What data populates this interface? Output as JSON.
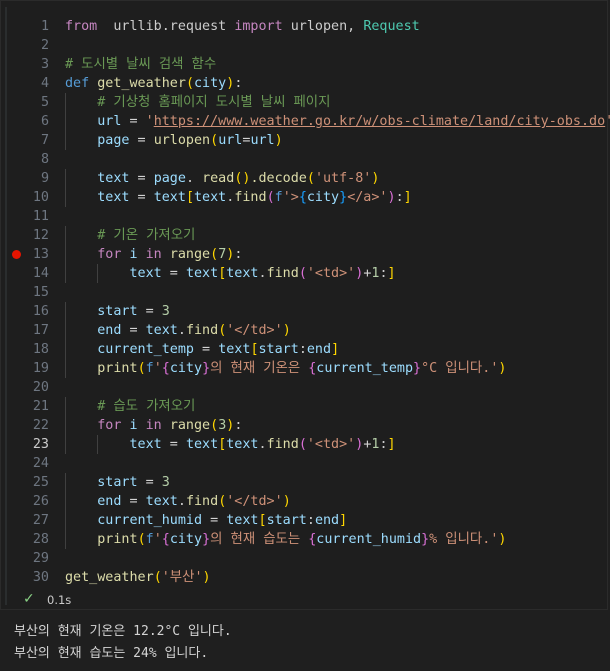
{
  "cell": {
    "lines": [
      {
        "n": "1",
        "t": [
          [
            "kw",
            "from"
          ],
          [
            "",
            "  "
          ],
          [
            "",
            "urllib.request "
          ],
          [
            "kw",
            "import"
          ],
          [
            "",
            " urlopen, "
          ],
          [
            "cls",
            "Request"
          ]
        ]
      },
      {
        "n": "2",
        "t": []
      },
      {
        "n": "3",
        "t": [
          [
            "cmt",
            "# 도시별 날씨 검색 함수"
          ]
        ]
      },
      {
        "n": "4",
        "t": [
          [
            "def",
            "def"
          ],
          [
            "",
            " "
          ],
          [
            "fn",
            "get_weather"
          ],
          [
            "b1",
            "("
          ],
          [
            "var",
            "city"
          ],
          [
            "b1",
            ")"
          ],
          [
            "",
            ":"
          ]
        ]
      },
      {
        "n": "5",
        "t": [
          [
            "",
            "    "
          ],
          [
            "cmt",
            "# 기상청 홈페이지 도시별 날씨 페이지"
          ]
        ]
      },
      {
        "n": "6",
        "t": [
          [
            "",
            "    "
          ],
          [
            "var",
            "url"
          ],
          [
            "op",
            " = "
          ],
          [
            "str",
            "'"
          ],
          [
            "str url",
            "https://www.weather.go.kr/w/obs-climate/land/city-obs.do"
          ],
          [
            "str",
            "'"
          ]
        ]
      },
      {
        "n": "7",
        "t": [
          [
            "",
            "    "
          ],
          [
            "var",
            "page"
          ],
          [
            "op",
            " = "
          ],
          [
            "fn",
            "urlopen"
          ],
          [
            "b1",
            "("
          ],
          [
            "var",
            "url"
          ],
          [
            "op",
            "="
          ],
          [
            "var",
            "url"
          ],
          [
            "b1",
            ")"
          ]
        ]
      },
      {
        "n": "8",
        "t": []
      },
      {
        "n": "9",
        "t": [
          [
            "",
            "    "
          ],
          [
            "var",
            "text"
          ],
          [
            "op",
            " = "
          ],
          [
            "var",
            "page"
          ],
          [
            "",
            ". "
          ],
          [
            "fn",
            "read"
          ],
          [
            "b1",
            "("
          ],
          [
            "b1",
            ")"
          ],
          [
            ".",
            ""
          ],
          [
            "fn",
            ".decode"
          ],
          [
            "b1",
            "("
          ],
          [
            "str",
            "'utf-8'"
          ],
          [
            "b1",
            ")"
          ]
        ]
      },
      {
        "n": "10",
        "t": [
          [
            "",
            "    "
          ],
          [
            "var",
            "text"
          ],
          [
            "op",
            " = "
          ],
          [
            "var",
            "text"
          ],
          [
            "b1",
            "["
          ],
          [
            "var",
            "text"
          ],
          [
            "",
            "."
          ],
          [
            "fn",
            "find"
          ],
          [
            "b2",
            "("
          ],
          [
            "def",
            "f"
          ],
          [
            "str",
            "'>"
          ],
          [
            "b3",
            "{"
          ],
          [
            "var",
            "city"
          ],
          [
            "b3",
            "}"
          ],
          [
            "str",
            "</a>'"
          ],
          [
            "b2",
            ")"
          ],
          [
            "",
            ":"
          ],
          [
            "b1",
            "]"
          ]
        ]
      },
      {
        "n": "11",
        "t": []
      },
      {
        "n": "12",
        "t": [
          [
            "",
            "    "
          ],
          [
            "cmt",
            "# 기온 가져오기"
          ]
        ]
      },
      {
        "n": "13",
        "bp": true,
        "t": [
          [
            "",
            "    "
          ],
          [
            "kw",
            "for"
          ],
          [
            "",
            " "
          ],
          [
            "var",
            "i"
          ],
          [
            "",
            " "
          ],
          [
            "kw",
            "in"
          ],
          [
            "",
            " "
          ],
          [
            "fn",
            "range"
          ],
          [
            "b1",
            "("
          ],
          [
            "num",
            "7"
          ],
          [
            "b1",
            ")"
          ],
          [
            "",
            ":"
          ]
        ]
      },
      {
        "n": "14",
        "t": [
          [
            "",
            "        "
          ],
          [
            "var",
            "text"
          ],
          [
            "op",
            " = "
          ],
          [
            "var",
            "text"
          ],
          [
            "b1",
            "["
          ],
          [
            "var",
            "text"
          ],
          [
            "",
            "."
          ],
          [
            "fn",
            "find"
          ],
          [
            "b2",
            "("
          ],
          [
            "str",
            "'<td>'"
          ],
          [
            "b2",
            ")"
          ],
          [
            "op",
            "+"
          ],
          [
            "num",
            "1"
          ],
          [
            "",
            ":"
          ],
          [
            "b1",
            "]"
          ]
        ]
      },
      {
        "n": "15",
        "t": []
      },
      {
        "n": "16",
        "t": [
          [
            "",
            "    "
          ],
          [
            "var",
            "start"
          ],
          [
            "op",
            " = "
          ],
          [
            "num",
            "3"
          ]
        ]
      },
      {
        "n": "17",
        "t": [
          [
            "",
            "    "
          ],
          [
            "var",
            "end"
          ],
          [
            "op",
            " = "
          ],
          [
            "var",
            "text"
          ],
          [
            "",
            "."
          ],
          [
            "fn",
            "find"
          ],
          [
            "b1",
            "("
          ],
          [
            "str",
            "'</td>'"
          ],
          [
            "b1",
            ")"
          ]
        ]
      },
      {
        "n": "18",
        "t": [
          [
            "",
            "    "
          ],
          [
            "var",
            "current_temp"
          ],
          [
            "op",
            " = "
          ],
          [
            "var",
            "text"
          ],
          [
            "b1",
            "["
          ],
          [
            "var",
            "start"
          ],
          [
            "",
            ":"
          ],
          [
            "var",
            "end"
          ],
          [
            "b1",
            "]"
          ]
        ]
      },
      {
        "n": "19",
        "t": [
          [
            "",
            "    "
          ],
          [
            "fn",
            "print"
          ],
          [
            "b1",
            "("
          ],
          [
            "def",
            "f"
          ],
          [
            "str",
            "'"
          ],
          [
            "b2",
            "{"
          ],
          [
            "var",
            "city"
          ],
          [
            "b2",
            "}"
          ],
          [
            "str",
            "의 현재 기온은 "
          ],
          [
            "b2",
            "{"
          ],
          [
            "var",
            "current_temp"
          ],
          [
            "b2",
            "}"
          ],
          [
            "str",
            "°C 입니다.'"
          ],
          [
            "b1",
            ")"
          ]
        ]
      },
      {
        "n": "20",
        "t": []
      },
      {
        "n": "21",
        "t": [
          [
            "",
            "    "
          ],
          [
            "cmt",
            "# 습도 가져오기"
          ]
        ]
      },
      {
        "n": "22",
        "t": [
          [
            "",
            "    "
          ],
          [
            "kw",
            "for"
          ],
          [
            "",
            " "
          ],
          [
            "var",
            "i"
          ],
          [
            "",
            " "
          ],
          [
            "kw",
            "in"
          ],
          [
            "",
            " "
          ],
          [
            "fn",
            "range"
          ],
          [
            "b1",
            "("
          ],
          [
            "num",
            "3"
          ],
          [
            "b1",
            ")"
          ],
          [
            "",
            ":"
          ]
        ]
      },
      {
        "n": "23",
        "active": true,
        "t": [
          [
            "",
            "        "
          ],
          [
            "var",
            "text"
          ],
          [
            "op",
            " = "
          ],
          [
            "var",
            "text"
          ],
          [
            "b1",
            "["
          ],
          [
            "var",
            "text"
          ],
          [
            "",
            "."
          ],
          [
            "fn",
            "find"
          ],
          [
            "b2",
            "("
          ],
          [
            "str",
            "'<td>'"
          ],
          [
            "b2",
            ")"
          ],
          [
            "op",
            "+"
          ],
          [
            "num",
            "1"
          ],
          [
            "",
            ":"
          ],
          [
            "b1",
            "]"
          ]
        ]
      },
      {
        "n": "24",
        "t": []
      },
      {
        "n": "25",
        "t": [
          [
            "",
            "    "
          ],
          [
            "var",
            "start"
          ],
          [
            "op",
            " = "
          ],
          [
            "num",
            "3"
          ]
        ]
      },
      {
        "n": "26",
        "t": [
          [
            "",
            "    "
          ],
          [
            "var",
            "end"
          ],
          [
            "op",
            " = "
          ],
          [
            "var",
            "text"
          ],
          [
            "",
            "."
          ],
          [
            "fn",
            "find"
          ],
          [
            "b1",
            "("
          ],
          [
            "str",
            "'</td>'"
          ],
          [
            "b1",
            ")"
          ]
        ]
      },
      {
        "n": "27",
        "t": [
          [
            "",
            "    "
          ],
          [
            "var",
            "current_humid"
          ],
          [
            "op",
            " = "
          ],
          [
            "var",
            "text"
          ],
          [
            "b1",
            "["
          ],
          [
            "var",
            "start"
          ],
          [
            "",
            ":"
          ],
          [
            "var",
            "end"
          ],
          [
            "b1",
            "]"
          ]
        ]
      },
      {
        "n": "28",
        "t": [
          [
            "",
            "    "
          ],
          [
            "fn",
            "print"
          ],
          [
            "b1",
            "("
          ],
          [
            "def",
            "f"
          ],
          [
            "str",
            "'"
          ],
          [
            "b2",
            "{"
          ],
          [
            "var",
            "city"
          ],
          [
            "b2",
            "}"
          ],
          [
            "str",
            "의 현재 습도는 "
          ],
          [
            "b2",
            "{"
          ],
          [
            "var",
            "current_humid"
          ],
          [
            "b2",
            "}"
          ],
          [
            "str",
            "% 입니다.'"
          ],
          [
            "b1",
            ")"
          ]
        ]
      },
      {
        "n": "29",
        "t": []
      },
      {
        "n": "30",
        "t": [
          [
            "fn",
            "get_weather"
          ],
          [
            "b1",
            "("
          ],
          [
            "str",
            "'부산'"
          ],
          [
            "b1",
            ")"
          ]
        ]
      }
    ]
  },
  "status": {
    "check_icon": "check-icon",
    "exec_time": "0.1s"
  },
  "output": {
    "lines": [
      "부산의 현재 기온은 12.2°C 입니다.",
      "부산의 현재 습도는 24% 입니다."
    ]
  }
}
